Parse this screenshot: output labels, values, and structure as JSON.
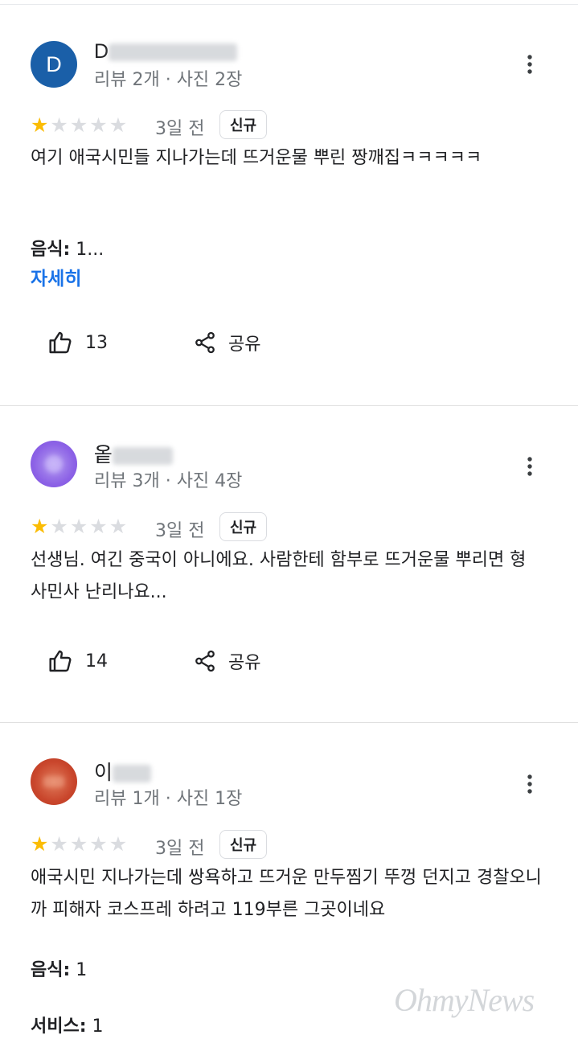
{
  "colors": {
    "accent_link": "#1a73e8",
    "star_on": "#fbbc04",
    "star_off": "#dadce0"
  },
  "reviews": [
    {
      "avatar_letter": "D",
      "avatar_color": "#1a5fa8",
      "name_visible": "D",
      "meta": "리뷰 2개 · 사진 2장",
      "rating": 1,
      "time": "3일 전",
      "badge": "신규",
      "text": "여기 애국시민들 지나가는데 뜨거운물 뿌린 짱깨집ㅋㅋㅋㅋㅋ",
      "attr1_label": "음식:",
      "attr1_value": "1...",
      "more_link": "자세히",
      "likes": "13",
      "share": "공유"
    },
    {
      "avatar_letter": "",
      "avatar_color": "#8b5cf6",
      "name_visible": "옽",
      "meta": "리뷰 3개 · 사진 4장",
      "rating": 1,
      "time": "3일 전",
      "badge": "신규",
      "text": "선생님. 여긴 중국이 아니에요. 사람한테 함부로 뜨거운물 뿌리면 형사민사 난리나요...",
      "likes": "14",
      "share": "공유"
    },
    {
      "avatar_letter": "",
      "avatar_color": "#c9462c",
      "name_visible": "이",
      "meta": "리뷰 1개 · 사진 1장",
      "rating": 1,
      "time": "3일 전",
      "badge": "신규",
      "text": "애국시민 지나가는데 쌍욕하고 뜨거운 만두찜기 뚜껑 던지고 경찰오니까 피해자 코스프레 하려고 119부른 그곳이네요",
      "attr1_label": "음식:",
      "attr1_value": "1",
      "attr2_label": "서비스:",
      "attr2_value": "1"
    }
  ],
  "watermark": "OhmyNews"
}
